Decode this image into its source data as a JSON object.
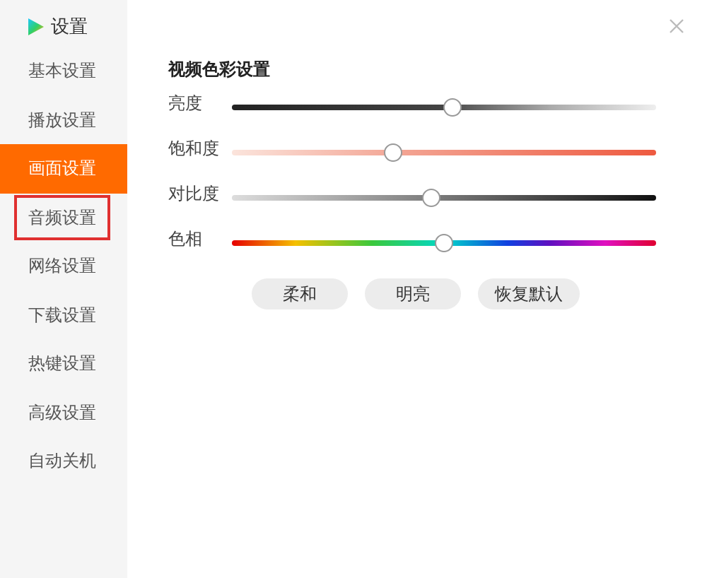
{
  "app": {
    "title": "设置"
  },
  "sidebar": {
    "items": [
      {
        "label": "基本设置",
        "selected": false,
        "outlined": false
      },
      {
        "label": "播放设置",
        "selected": false,
        "outlined": false
      },
      {
        "label": "画面设置",
        "selected": true,
        "outlined": false
      },
      {
        "label": "音频设置",
        "selected": false,
        "outlined": true
      },
      {
        "label": "网络设置",
        "selected": false,
        "outlined": false
      },
      {
        "label": "下载设置",
        "selected": false,
        "outlined": false
      },
      {
        "label": "热键设置",
        "selected": false,
        "outlined": false
      },
      {
        "label": "高级设置",
        "selected": false,
        "outlined": false
      },
      {
        "label": "自动关机",
        "selected": false,
        "outlined": false
      }
    ]
  },
  "section": {
    "title": "视频色彩设置",
    "sliders": [
      {
        "label": "亮度",
        "kind": "brightness",
        "level": 0.52
      },
      {
        "label": "饱和度",
        "kind": "saturation",
        "level": 0.38
      },
      {
        "label": "对比度",
        "kind": "contrast",
        "level": 0.47
      },
      {
        "label": "色相",
        "kind": "hue",
        "level": 0.5
      }
    ],
    "buttons": [
      "柔和",
      "明亮",
      "恢复默认"
    ]
  }
}
